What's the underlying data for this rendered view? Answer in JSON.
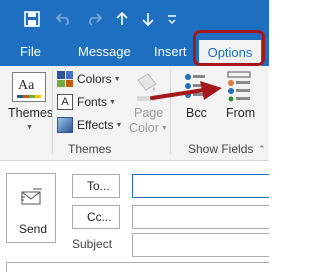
{
  "titlebar": {
    "icons": [
      "save-icon",
      "undo-icon",
      "redo-icon",
      "up-arrow-icon",
      "down-arrow-icon",
      "customize-dropdown-icon"
    ]
  },
  "tabs": {
    "file": "File",
    "message": "Message",
    "insert": "Insert",
    "options": "Options"
  },
  "ribbon": {
    "themes_label": "Themes",
    "colors_label": "Colors",
    "fonts_label": "Fonts",
    "effects_label": "Effects",
    "page_color_line1": "Page",
    "page_color_line2": "Color",
    "bcc_label": "Bcc",
    "from_label": "From",
    "group_themes": "Themes",
    "group_show_fields": "Show Fields",
    "aa_text": "Aa"
  },
  "compose": {
    "send_label": "Send",
    "to_label": "To...",
    "cc_label": "Cc...",
    "subject_label": "Subject"
  },
  "colors": {
    "accent_blue": "#1e6fbf",
    "highlight_red": "#a6171b"
  }
}
